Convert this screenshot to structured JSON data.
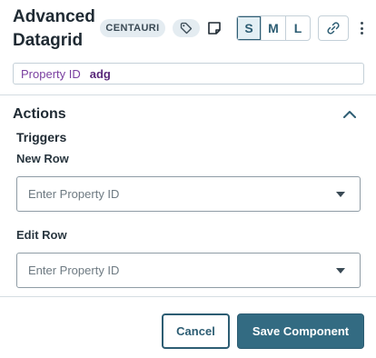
{
  "header": {
    "title": "Advanced Datagrid",
    "tenant_chip": "CENTAURI",
    "tag_icon": "tag-icon",
    "note_icon": "note-icon",
    "sizes": [
      {
        "label": "S",
        "active": true
      },
      {
        "label": "M",
        "active": false
      },
      {
        "label": "L",
        "active": false
      }
    ],
    "link_icon": "link-icon",
    "more_icon": "kebab-menu-icon"
  },
  "property": {
    "label": "Property ID",
    "value": "adg"
  },
  "actions": {
    "title": "Actions",
    "collapse_icon": "chevron-up-icon",
    "triggers_title": "Triggers",
    "new_row": {
      "label": "New Row",
      "placeholder": "Enter Property ID"
    },
    "edit_row": {
      "label": "Edit Row",
      "placeholder": "Enter Property ID"
    }
  },
  "footer": {
    "cancel_label": "Cancel",
    "save_label": "Save Component"
  },
  "colors": {
    "accent": "#336b82",
    "property_label": "#7a3fa0"
  }
}
